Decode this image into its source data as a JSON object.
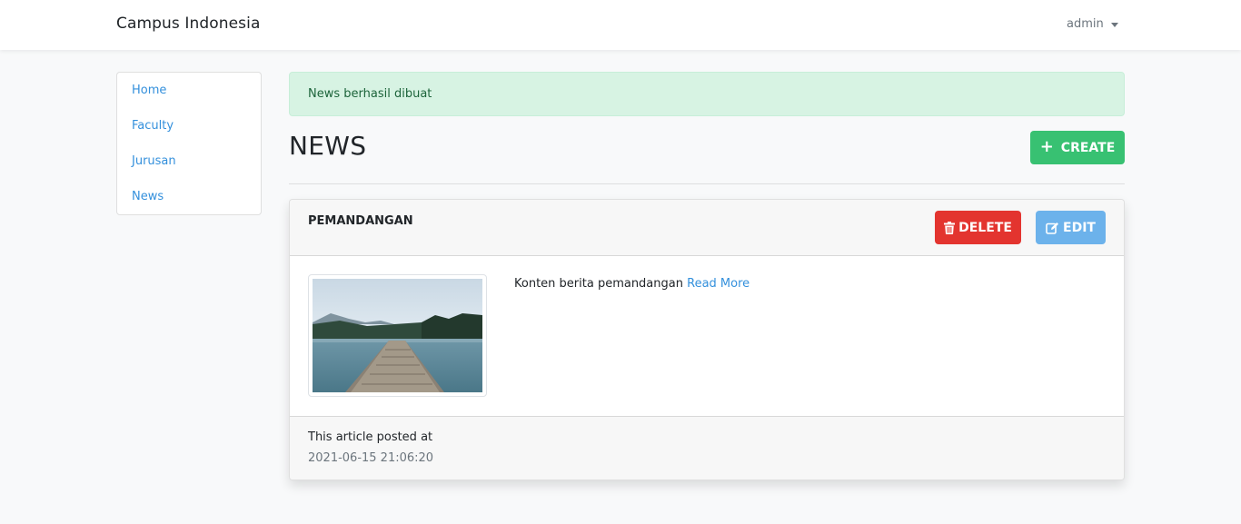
{
  "navbar": {
    "brand": "Campus Indonesia",
    "user": "admin"
  },
  "sidebar": {
    "items": [
      {
        "label": "Home"
      },
      {
        "label": "Faculty"
      },
      {
        "label": "Jurusan"
      },
      {
        "label": "News"
      }
    ]
  },
  "alert": {
    "message": "News berhasil dibuat"
  },
  "page": {
    "title": "NEWS",
    "create_label": "CREATE"
  },
  "article": {
    "title": "PEMANDANGAN",
    "delete_label": "DELETE",
    "edit_label": "EDIT",
    "content": "Konten berita pemandangan",
    "read_more": "Read More",
    "posted_label": "This article posted at",
    "posted_at": "2021-06-15 21:06:20"
  },
  "colors": {
    "primary": "#3490dc",
    "success": "#38c172",
    "danger": "#e3342f",
    "info": "#6cb2eb",
    "alert_bg": "#d7f3e3"
  }
}
